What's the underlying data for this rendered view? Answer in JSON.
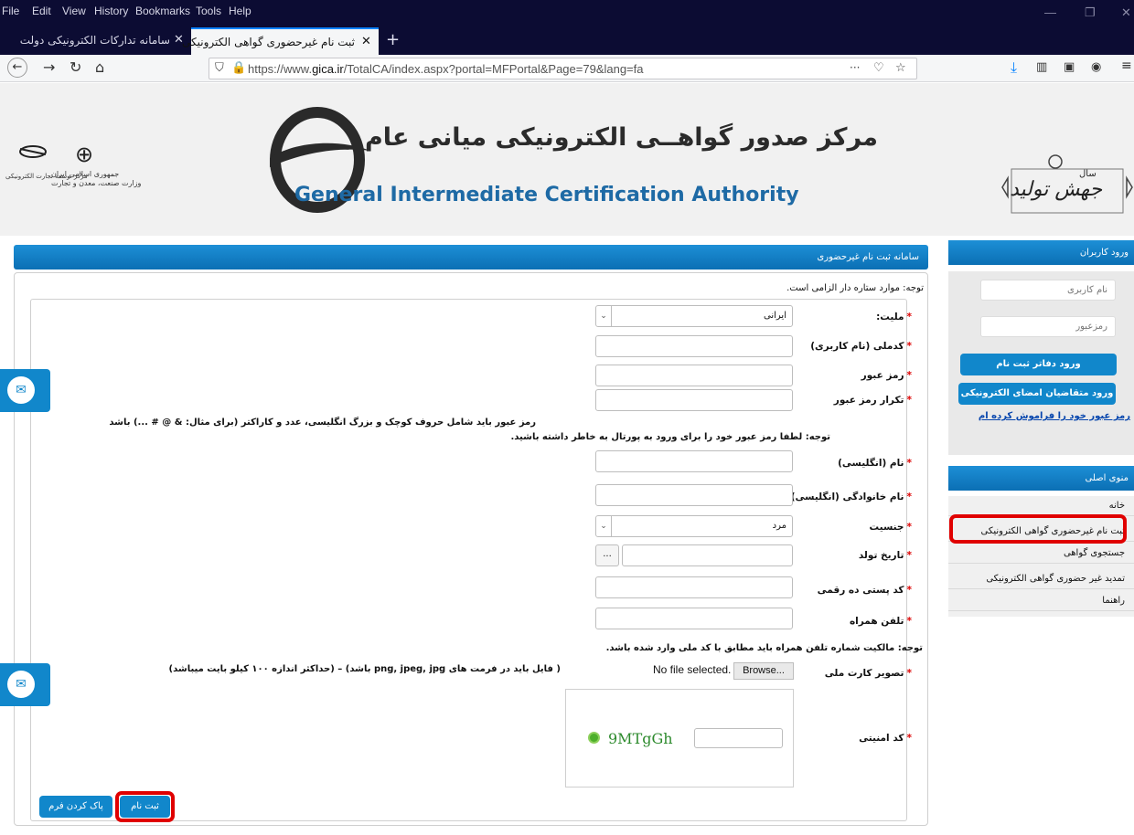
{
  "browser": {
    "menu": [
      "File",
      "Edit",
      "View",
      "History",
      "Bookmarks",
      "Tools",
      "Help"
    ],
    "tabs": [
      {
        "title": "سامانه تدارکات الکترونیکی دولت",
        "active": false
      },
      {
        "title": "ثبت نام غیرحضوری گواهی الکترونیکی",
        "active": true
      }
    ],
    "url_prefix": "https://www.",
    "url_domain": "gica.ir",
    "url_rest": "/TotalCA/index.aspx?portal=MFPortal&Page=79&lang=fa",
    "url_more": "···"
  },
  "banner": {
    "title_fa": "مرکز صدور گواهــی الکترونیکی میانی عام",
    "title_en": "General Intermediate Certification Authority",
    "left_logo_line1": "جمهوری اسلامی ایران",
    "left_logo_line2": "وزارت صنعت، معدن و تجارت",
    "left_logo_line3": "مرکز توسعه تجارت الکترونیکی",
    "year_text": "جهش تولید",
    "year_label": "سال"
  },
  "main": {
    "header": "سامانه ثبت نام غیرحضوری",
    "required_note": "توجه: موارد ستاره دار الزامی است.",
    "fields": {
      "nationality_label": "ملیت:",
      "nationality_value": "ایرانی",
      "national_code_label": "کدملی (نام کاربری)",
      "password_label": "رمز عبور",
      "password_repeat_label": "تکرار رمز عبور",
      "password_note1": "رمز عبور باید شامل حروف کوچک و بزرگ انگلیسی، عدد و کاراکتر (برای مثال: & @ # ...) باشد",
      "password_note2": "توجه: لطفا رمز عبور خود را برای ورود به پورتال به خاطر داشته باشید.",
      "first_name_label": "نام (انگلیسی)",
      "last_name_label": "نام خانوادگی (انگلیسی)",
      "gender_label": "جنسیت",
      "gender_value": "مرد",
      "birth_date_label": "تاریخ تولد",
      "date_button": "...",
      "postal_code_label": "کد پستی ده رقمی",
      "mobile_label": "تلفن همراه",
      "mobile_note": "توجه: مالکیت شماره تلفن همراه باید مطابق با کد ملی وارد شده باشد.",
      "id_card_label": "تصویر کارت ملی",
      "browse_label": "Browse...",
      "file_status": "No file selected.",
      "file_note": "( فایل باید در فرمت های png, jpeg, jpg باشد) – (حداکثر اندازه ۱۰۰ کیلو بایت میباشد)",
      "captcha_label": "کد امنیتی",
      "captcha_text": "9MTgGh"
    },
    "submit_button": "ثبت نام",
    "clear_button": "پاک کردن فرم"
  },
  "sidebar": {
    "login_header": "ورود کاربران",
    "username_placeholder": "نام کاربری",
    "password_placeholder": "رمزعبور",
    "office_login_button": "ورود دفاتر ثبت نام",
    "applicant_login_button": "ورود متقاضیان امضای الکترونیکی",
    "forgot_link": "رمز عبور خود را فراموش کرده ام",
    "menu_header": "منوی اصلی",
    "menu_items": [
      "خانه",
      "ثبت نام غیرحضوری گواهی الکترونیکی",
      "جستجوی گواهی",
      "تمدید غیر حضوری گواهی الکترونیکی",
      "راهنما"
    ]
  },
  "colors": {
    "accent": "#1187cb",
    "highlight": "#e00000",
    "chrome": "#0c0c33"
  }
}
